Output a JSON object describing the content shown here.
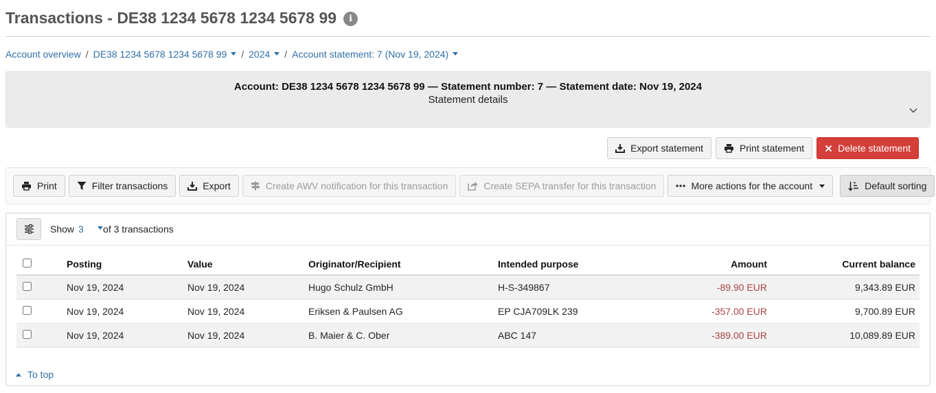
{
  "page": {
    "title": "Transactions - DE38 1234 5678 1234 5678 99"
  },
  "breadcrumb": {
    "overview": "Account overview",
    "account": "DE38 1234 5678 1234 5678 99",
    "year": "2024",
    "statement": "Account statement: 7 (Nov 19, 2024)",
    "separator": "/"
  },
  "statement": {
    "heading": "Account: DE38 1234 5678 1234 5678 99 — Statement number: 7 — Statement date: Nov 19, 2024",
    "subheading": "Statement details"
  },
  "statement_actions": {
    "export": "Export statement",
    "print": "Print statement",
    "delete": "Delete statement"
  },
  "toolbar": {
    "print": "Print",
    "filter": "Filter transactions",
    "export": "Export",
    "awv": "Create AWV notification for this transaction",
    "sepa": "Create SEPA transfer for this transaction",
    "more": "More actions for the account",
    "sorting": "Default sorting"
  },
  "list": {
    "show_label": "Show",
    "show_value": "3",
    "of_label": "of 3 transactions"
  },
  "table": {
    "headers": {
      "posting": "Posting",
      "value": "Value",
      "originator": "Originator/Recipient",
      "purpose": "Intended purpose",
      "amount": "Amount",
      "balance": "Current balance"
    },
    "rows": [
      {
        "posting": "Nov 19, 2024",
        "value": "Nov 19, 2024",
        "originator": "Hugo Schulz GmbH",
        "purpose": "H-S-349867",
        "amount": "-89.90 EUR",
        "balance": "9,343.89 EUR"
      },
      {
        "posting": "Nov 19, 2024",
        "value": "Nov 19, 2024",
        "originator": "Eriksen & Paulsen AG",
        "purpose": "EP CJA709LK 239",
        "amount": "-357.00 EUR",
        "balance": "9,700.89 EUR"
      },
      {
        "posting": "Nov 19, 2024",
        "value": "Nov 19, 2024",
        "originator": "B. Maier & C. Ober",
        "purpose": "ABC 147",
        "amount": "-389.00 EUR",
        "balance": "10,089.89 EUR"
      }
    ]
  },
  "footer": {
    "to_top": "To top"
  },
  "colors": {
    "link": "#2f6fa7",
    "danger": "#d43f3a",
    "negative_amount": "#a94442"
  },
  "icons": [
    "info-icon",
    "caret-down-icon",
    "chevron-down-icon",
    "download-icon",
    "printer-icon",
    "close-icon",
    "filter-icon",
    "signpost-icon",
    "share-icon",
    "ellipsis-icon",
    "sort-icon",
    "sliders-icon",
    "caret-up-icon"
  ]
}
